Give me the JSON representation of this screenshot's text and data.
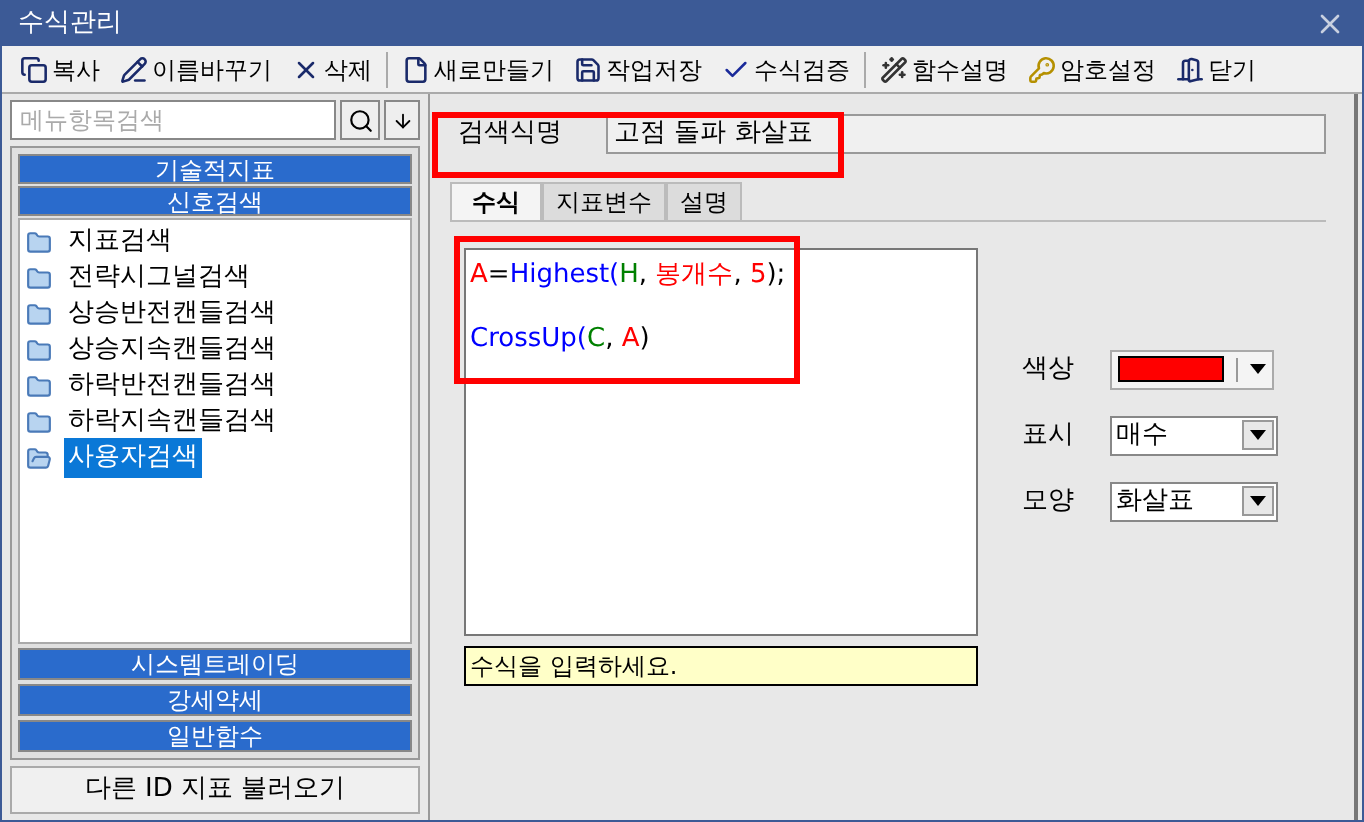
{
  "window": {
    "title": "수식관리"
  },
  "toolbar": [
    {
      "kind": "copy",
      "label": "복사"
    },
    {
      "kind": "rename",
      "label": "이름바꾸기"
    },
    {
      "kind": "delete",
      "label": "삭제"
    },
    {
      "kind": "new",
      "label": "새로만들기"
    },
    {
      "kind": "save",
      "label": "작업저장"
    },
    {
      "kind": "verify",
      "label": "수식검증"
    },
    {
      "kind": "help",
      "label": "함수설명"
    },
    {
      "kind": "password",
      "label": "암호설정"
    },
    {
      "kind": "close",
      "label": "닫기"
    }
  ],
  "sidebar": {
    "search": {
      "placeholder": "메뉴항목검색"
    },
    "top_sections": [
      "기술적지표",
      "신호검색"
    ],
    "tree": [
      {
        "label": "지표검색",
        "selected": false
      },
      {
        "label": "전략시그널검색",
        "selected": false
      },
      {
        "label": "상승반전캔들검색",
        "selected": false
      },
      {
        "label": "상승지속캔들검색",
        "selected": false
      },
      {
        "label": "하락반전캔들검색",
        "selected": false
      },
      {
        "label": "하락지속캔들검색",
        "selected": false
      },
      {
        "label": "사용자검색",
        "selected": true
      }
    ],
    "bottom_sections": [
      "시스템트레이딩",
      "강세약세",
      "일반함수"
    ],
    "load_button": "다른 ID 지표 불러오기"
  },
  "name_field": {
    "label": "검색식명",
    "value": "고점 돌파 화살표"
  },
  "tabs": [
    {
      "label": "수식",
      "selected": true
    },
    {
      "label": "지표변수",
      "selected": false
    },
    {
      "label": "설명",
      "selected": false
    }
  ],
  "code_lines": [
    [
      {
        "text": "A",
        "color": "#ff0000"
      },
      {
        "text": "=",
        "color": "#000000"
      },
      {
        "text": "Highest(",
        "color": "#0000ff"
      },
      {
        "text": "H",
        "color": "#008000"
      },
      {
        "text": ", ",
        "color": "#000000"
      },
      {
        "text": "봉개수",
        "color": "#ff0000"
      },
      {
        "text": ", ",
        "color": "#000000"
      },
      {
        "text": "5",
        "color": "#ff0000"
      },
      {
        "text": ");",
        "color": "#000000"
      }
    ],
    [
      {
        "text": "CrossUp(",
        "color": "#0000ff"
      },
      {
        "text": "C",
        "color": "#008000"
      },
      {
        "text": ", ",
        "color": "#000000"
      },
      {
        "text": "A",
        "color": "#ff0000"
      },
      {
        "text": ")",
        "color": "#000000"
      }
    ]
  ],
  "hint": "수식을 입력하세요.",
  "options": [
    {
      "kind": "color",
      "label": "색상",
      "color": "#ff0000"
    },
    {
      "kind": "select",
      "label": "표시",
      "value": "매수"
    },
    {
      "kind": "select",
      "label": "모양",
      "value": "화살표"
    }
  ]
}
